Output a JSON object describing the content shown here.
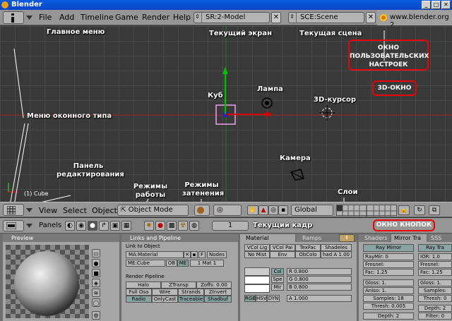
{
  "window": {
    "title": "Blender",
    "btn_min": "_",
    "btn_max": "□",
    "btn_close": "✕"
  },
  "topbar": {
    "menus": [
      "File",
      "Add",
      "Timeline",
      "Game",
      "Render",
      "Help"
    ],
    "screen": "SR:2-Model",
    "scene": "SCE:Scene",
    "url": "www.blender.org 2"
  },
  "annotations": {
    "main_menu": "Главное меню",
    "current_screen": "Текущий экран",
    "current_scene": "Текущая сцена",
    "user_prefs": "ОКНО ПОЛЬЗОВАТЕЛЬСКИХ НАСТРОЕК",
    "window_3d": "3D-ОКНО",
    "cube": "Куб",
    "lamp": "Лампа",
    "cursor3d": "3D-курсор",
    "window_type_menu": "Меню оконного типа",
    "camera": "Камера",
    "edit_panel": "Панель редактирования",
    "work_modes": "Режимы работы",
    "shading_modes": "Режимы затенения",
    "layers": "Слои",
    "current_frame": "Текущий кадр",
    "buttons_window": "ОКНО КНОПОК"
  },
  "viewport": {
    "object_label": "(1) Cube"
  },
  "view_header": {
    "menus": [
      "View",
      "Select",
      "Object"
    ],
    "mode": "Object Mode",
    "pivot": "Global"
  },
  "panels_header": {
    "label": "Panels",
    "frame": "1"
  },
  "preview_panel": {
    "title": "Preview"
  },
  "links_panel": {
    "title": "Links and Pipeline",
    "link_label": "Link to Object",
    "material": "MA:Material",
    "f_btn": "F",
    "nodes": "Nodes",
    "mesh": "ME:Cube",
    "ob": "OB",
    "me": "ME",
    "mat_count": "1 Mat 1",
    "render_pipeline": "Render Pipeline",
    "pipeline_buttons": [
      "Halo",
      "ZTransp",
      "Zoffs: 0.00",
      "Full Osa",
      "Wire",
      "Strands",
      "ZInvert",
      "Radio",
      "OnlyCast",
      "Traceable",
      "Shadbuf"
    ]
  },
  "material_panel": {
    "tabs": [
      "Material",
      "Ramps"
    ],
    "row1": [
      "VCol Lig",
      "VCol Pai",
      "TexFac",
      "Shadeles"
    ],
    "row2": [
      "No Mist",
      "Env",
      "ObColo",
      "had A 1.00"
    ],
    "col": "Col",
    "spe": "Spe",
    "mir": "Mir",
    "r": "R 0.800",
    "g": "G 0.800",
    "b": "B 0.800",
    "modes": [
      "RGB",
      "HSV",
      "DYN"
    ],
    "alpha": "A 1.000"
  },
  "shaders_panel": {
    "tabs": [
      "Shaders",
      "Mirror Tra",
      "SSS"
    ],
    "ray_mirror": "Ray Mirror",
    "raymir": "RayMir: 0",
    "fresnel": "Fresnel:",
    "fac": "Fac: 1.25",
    "gloss": "Gloss: 1.",
    "aniso": "Aniso: 1.",
    "samples": "Samples: 18",
    "thresh": "Thresh: 0.005",
    "depth": "Depth: 2",
    "ray_transp": "Ray Tra",
    "ior": "IOR: 1.0",
    "fresnel2": "Fresnel:",
    "fac2": "Fac: 1.25",
    "gloss2": "Gloss: 1.",
    "samples2": "Samples:",
    "thresh2": "Thresh: 0",
    "depth2": "Depth: 2",
    "filter": "Filter: 0"
  }
}
